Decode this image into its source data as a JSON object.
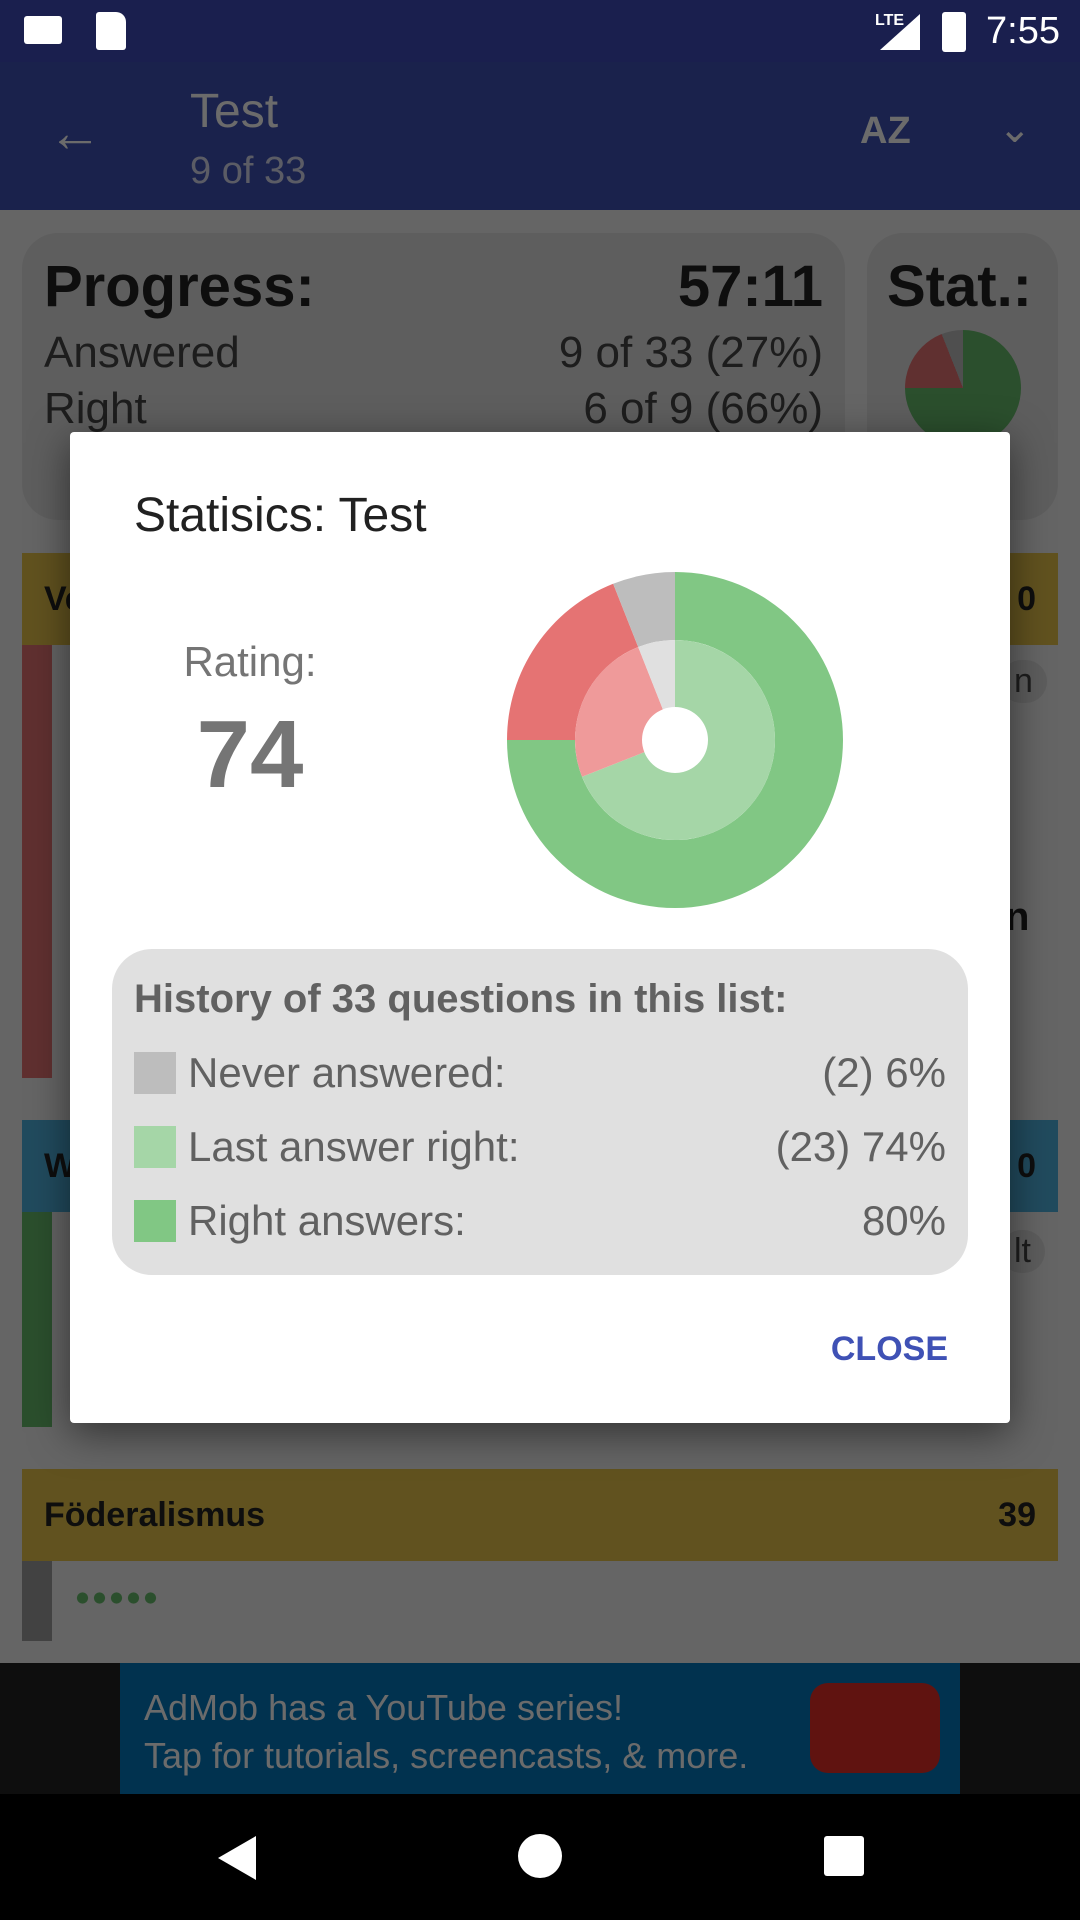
{
  "status_bar": {
    "time": "7:55",
    "network": "LTE",
    "icons": [
      "gmail-icon",
      "sd-card-icon",
      "signal-icon",
      "battery-charging-icon"
    ]
  },
  "app_bar": {
    "title": "Test",
    "subtitle": "9 of 33",
    "icons": [
      "back-arrow-icon",
      "sort-az-icon",
      "chevron-down-icon"
    ]
  },
  "progress": {
    "title": "Progress:",
    "timer": "57:11",
    "answered_label": "Answered",
    "answered_value": "9 of 33 (27%)",
    "right_label": "Right",
    "right_value": "6 of 9 (66%)"
  },
  "stat_card": {
    "title": "Stat.:"
  },
  "sections": [
    {
      "label": "Ve",
      "count": "0",
      "color": "#e8c44a",
      "bar": "#e57373",
      "chip": "n",
      "extra": "n"
    },
    {
      "label": "W",
      "count": "0",
      "color": "#4fb3e0",
      "bar": "#66bb6a",
      "chip": "lt"
    },
    {
      "label": "Föderalismus",
      "count": "39",
      "color": "#e8c44a",
      "bar": "#9e9e9e"
    }
  ],
  "ad": {
    "line1": "AdMob has a YouTube series!",
    "line2": "Tap for tutorials, screencasts, & more."
  },
  "dialog": {
    "title": "Statisics: Test",
    "rating_label": "Rating:",
    "rating_value": "74",
    "history_title": "History of 33 questions in this list:",
    "legend": [
      {
        "label": "Never answered:",
        "value": "(2) 6%",
        "color": "#bdbdbd"
      },
      {
        "label": "Last answer right:",
        "value": "(23) 74%",
        "color": "#a5d6a7"
      },
      {
        "label": "Right answers:",
        "value": "80%",
        "color": "#81c784"
      }
    ],
    "close_label": "CLOSE",
    "accent": "#3f51b5"
  },
  "chart_data": {
    "type": "donut",
    "rings": [
      {
        "ring": "outer",
        "values": [
          {
            "category": "right",
            "value": 75,
            "color": "#81c784"
          },
          {
            "category": "wrong",
            "value": 19,
            "color": "#e57373"
          },
          {
            "category": "never",
            "value": 6,
            "color": "#bdbdbd"
          }
        ]
      },
      {
        "ring": "inner",
        "values": [
          {
            "category": "last right",
            "value": 69,
            "color": "#a5d6a7"
          },
          {
            "category": "last wrong",
            "value": 25,
            "color": "#ef9a9a"
          },
          {
            "category": "never",
            "value": 6,
            "color": "#e0e0e0"
          }
        ]
      }
    ]
  }
}
